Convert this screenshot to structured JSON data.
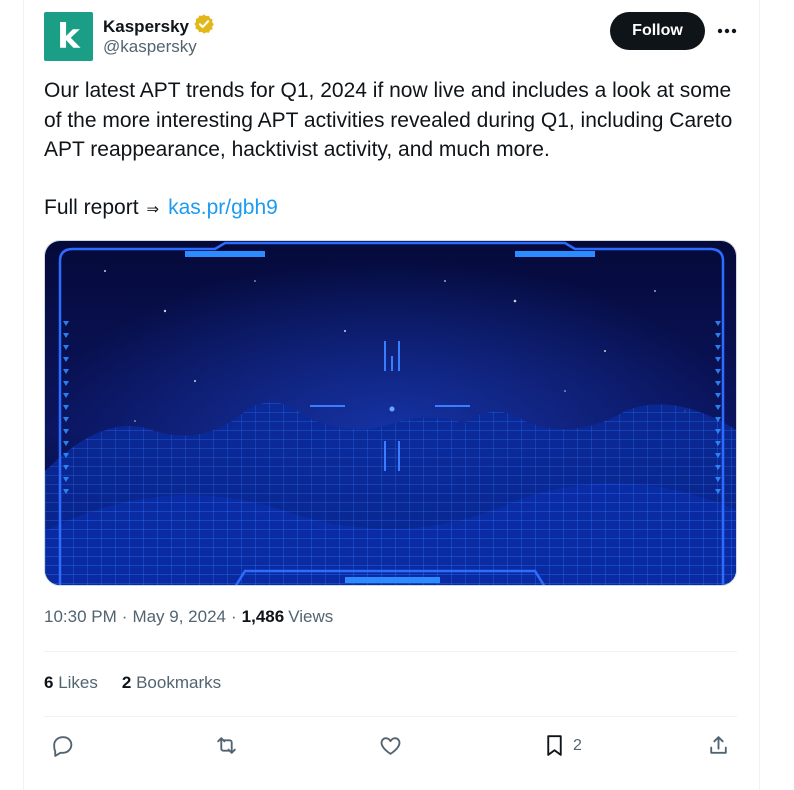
{
  "author": {
    "avatar_letter": "k",
    "display_name": "Kaspersky",
    "handle": "@kaspersky",
    "verified_icon": "verified-badge-gold",
    "brand_color": "#1a9e85"
  },
  "follow_label": "Follow",
  "tweet": {
    "text": "Our latest APT trends for Q1, 2024 if now live and includes a look at some of the more interesting APT activities revealed during Q1, including Careto APT reappearance, hacktivist activity, and much more.",
    "report_label": "Full report",
    "arrow": "⇒",
    "link": "kas.pr/gbh9"
  },
  "meta": {
    "time": "10:30 PM",
    "sep1": "·",
    "date": "May 9, 2024",
    "sep2": "·",
    "views_count": "1,486",
    "views_label": "Views"
  },
  "stats": {
    "likes_count": "6",
    "likes_label": "Likes",
    "bookmarks_count": "2",
    "bookmarks_label": "Bookmarks"
  },
  "actions": {
    "bookmark_count": "2"
  },
  "colors": {
    "text": "#0f1419",
    "secondary": "#536471",
    "link": "#1d9bf0",
    "verified": "#e2b719"
  }
}
